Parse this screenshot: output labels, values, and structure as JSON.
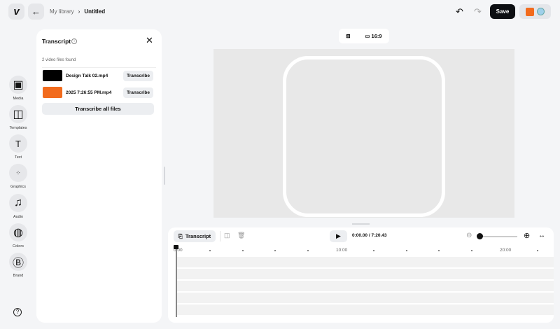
{
  "header": {
    "breadcrumb_parent": "My library",
    "breadcrumb_current": "Untitled",
    "save_label": "Save"
  },
  "sidebar": {
    "items": [
      {
        "label": "Media",
        "icon": "image-icon"
      },
      {
        "label": "Templates",
        "icon": "layout-icon"
      },
      {
        "label": "Text",
        "icon": "text-icon"
      },
      {
        "label": "Graphics",
        "icon": "shapes-icon"
      },
      {
        "label": "Audio",
        "icon": "music-icon"
      },
      {
        "label": "Colors",
        "icon": "palette-icon"
      },
      {
        "label": "Brand",
        "icon": "brand-icon"
      }
    ]
  },
  "panel": {
    "title": "Transcript",
    "count": "2 video files found",
    "files": [
      {
        "name": "Design Talk 02.mp4",
        "action": "Transcribe",
        "thumb": "#000000"
      },
      {
        "name": "2025 7:26:55 PM.mp4",
        "action": "Transcribe",
        "thumb": "#f26b1d"
      }
    ],
    "all_label": "Transcribe all files"
  },
  "canvas": {
    "aspect": "16:9"
  },
  "timeline": {
    "transcript_label": "Transcript",
    "time": "0:00.00 / 7:20.43",
    "ticks": [
      "0:00",
      "10:00",
      "20:00"
    ],
    "zoom_level": 0
  }
}
